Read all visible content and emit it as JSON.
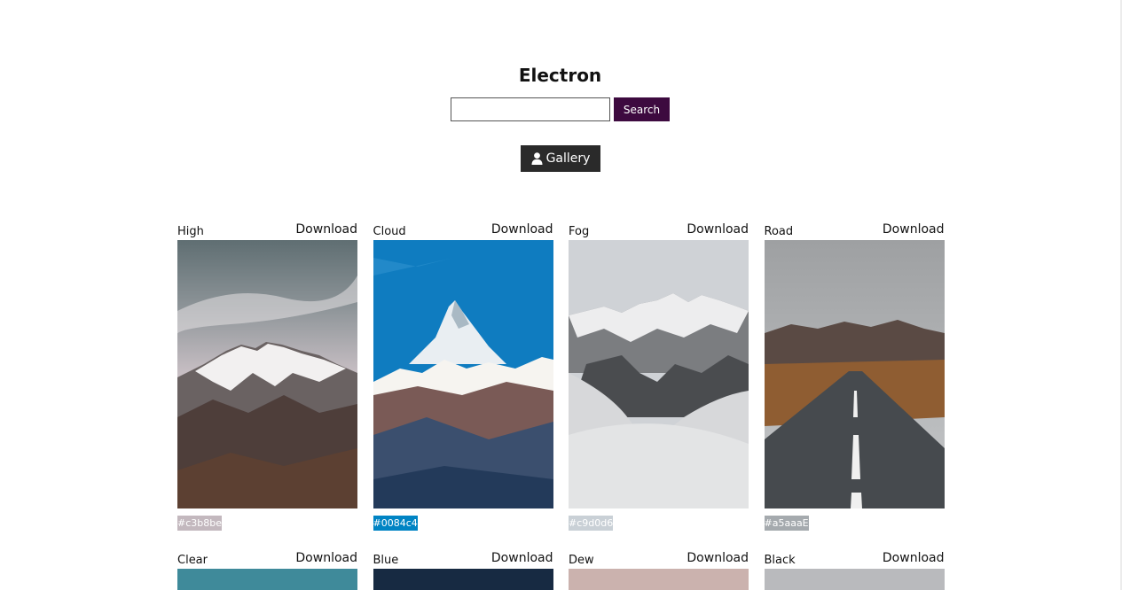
{
  "header": {
    "title": "Electron"
  },
  "search": {
    "placeholder": "",
    "value": "",
    "button_label": "Search"
  },
  "gallery_button": {
    "label": "Gallery",
    "icon": "user-icon"
  },
  "cards": [
    {
      "name": "High",
      "download_label": "Download",
      "color": "#c3b8be"
    },
    {
      "name": "Cloud",
      "download_label": "Download",
      "color": "#0084c4"
    },
    {
      "name": "Fog",
      "download_label": "Download",
      "color": "#c9d0d6"
    },
    {
      "name": "Road",
      "download_label": "Download",
      "color": "#a5aaaE"
    },
    {
      "name": "Clear",
      "download_label": "Download"
    },
    {
      "name": "Blue",
      "download_label": "Download"
    },
    {
      "name": "Dew",
      "download_label": "Download"
    },
    {
      "name": "Black",
      "download_label": "Download"
    }
  ],
  "colors": {
    "search_button_bg": "#3d0a3f",
    "gallery_button_bg": "#2a2a2a"
  }
}
